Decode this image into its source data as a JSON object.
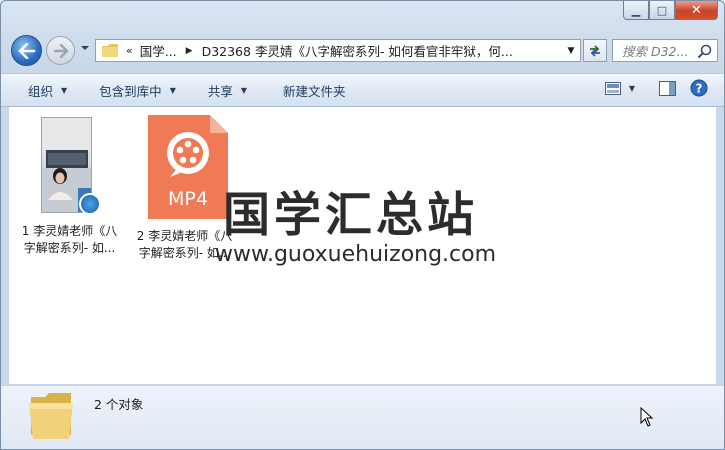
{
  "window": {
    "minimize_glyph": "▁",
    "maximize_glyph": "□",
    "close_glyph": "✕"
  },
  "address": {
    "collapsed_marker": "«",
    "crumb_1": "国学...",
    "crumb_2": "D32368 李灵婧《八字解密系列- 如何看官非牢狱，何...",
    "dropdown_icon": "chevron-down-icon"
  },
  "search": {
    "placeholder": "搜索 D32..."
  },
  "toolbar": {
    "organize": "组织",
    "include_in_library": "包含到库中",
    "share": "共享",
    "new_folder": "新建文件夹"
  },
  "files": [
    {
      "label": "1 李灵婧老师《八字解密系列- 如...",
      "label_line1": "1 李灵婧老师《八",
      "label_line2": "字解密系列- 如...",
      "icon": "video-thumbnail-icon"
    },
    {
      "label": "2 李灵婧老师《八字解密系列- 如...",
      "label_line1": "2 李灵婧老师《八",
      "label_line2": "字解密系列- 如...",
      "icon": "mp4-file-icon",
      "badge_text": "MP4"
    }
  ],
  "watermark": {
    "title": "国学汇总站",
    "url": "www.guoxuehuizong.com"
  },
  "details": {
    "count_text": "2 个对象"
  },
  "colors": {
    "mp4_orange": "#f07a56",
    "window_frame": "#c9d8ea",
    "close_red": "#c7432a"
  }
}
